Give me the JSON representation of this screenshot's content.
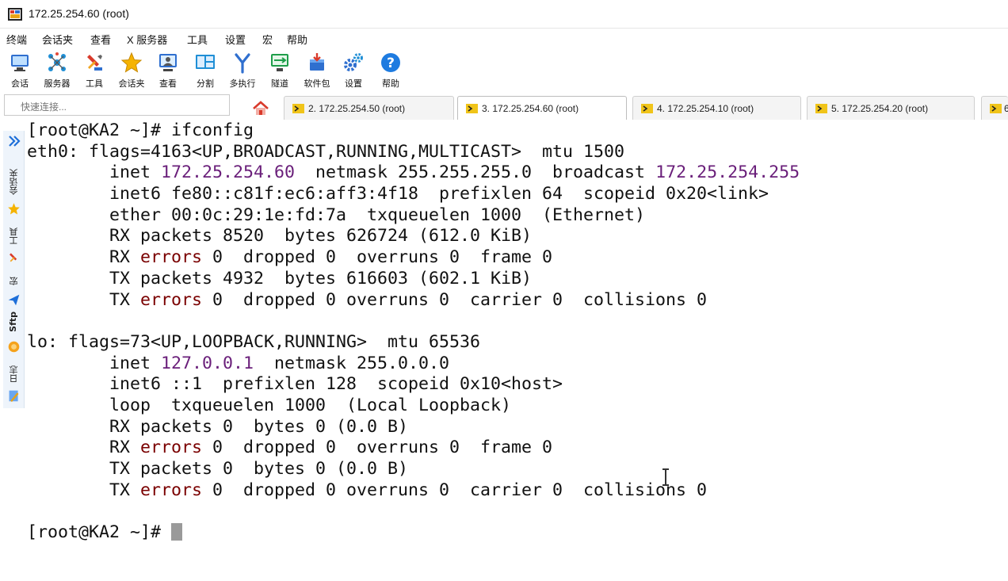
{
  "window": {
    "title": "172.25.254.60 (root)"
  },
  "menu": [
    "终端",
    "会话夹",
    "查看",
    "X 服务器",
    "工具",
    "设置",
    "宏",
    "帮助"
  ],
  "toolbar": [
    {
      "label": "会话",
      "icon": "session-icon"
    },
    {
      "label": "服务器",
      "icon": "servers-icon"
    },
    {
      "label": "工具",
      "icon": "tools-icon"
    },
    {
      "label": "会话夹",
      "icon": "favorites-star-icon"
    },
    {
      "label": "查看",
      "icon": "view-icon"
    },
    {
      "label": "分割",
      "icon": "split-icon"
    },
    {
      "label": "多执行",
      "icon": "multiexec-icon"
    },
    {
      "label": "隧道",
      "icon": "tunnel-icon"
    },
    {
      "label": "软件包",
      "icon": "packages-icon"
    },
    {
      "label": "设置",
      "icon": "settings-gears-icon"
    },
    {
      "label": "帮助",
      "icon": "help-icon"
    }
  ],
  "quick_connect": {
    "placeholder": "快速连接..."
  },
  "tabs": [
    {
      "label": "2. 172.25.254.50 (root)",
      "active": false
    },
    {
      "label": "3. 172.25.254.60 (root)",
      "active": true
    },
    {
      "label": "4. 172.25.254.10 (root)",
      "active": false
    },
    {
      "label": "5. 172.25.254.20 (root)",
      "active": false
    },
    {
      "label": "6",
      "active": false
    }
  ],
  "sidebar": {
    "sessions": "会话夹",
    "tools": "工具",
    "macros": "宏",
    "sftp": "Sftp",
    "log": "日志"
  },
  "colors": {
    "ip": "#6a1f7a",
    "error": "#7a0000",
    "accent": "#1e6fd9"
  },
  "terminal": {
    "lines": [
      [
        {
          "t": "[root@KA2 ~]# ifconfig"
        }
      ],
      [
        {
          "t": "eth0: flags=4163<UP,BROADCAST,RUNNING,MULTICAST>  mtu 1500"
        }
      ],
      [
        {
          "t": "        inet "
        },
        {
          "t": "172.25.254.60",
          "c": "ip"
        },
        {
          "t": "  netmask 255.255.255.0  broadcast "
        },
        {
          "t": "172.25.254.255",
          "c": "ip"
        }
      ],
      [
        {
          "t": "        inet6 fe80::c81f:ec6:aff3:4f18  prefixlen 64  scopeid 0x20<link>"
        }
      ],
      [
        {
          "t": "        ether 00:0c:29:1e:fd:7a  txqueuelen 1000  (Ethernet)"
        }
      ],
      [
        {
          "t": "        RX packets 8520  bytes 626724 (612.0 KiB)"
        }
      ],
      [
        {
          "t": "        RX "
        },
        {
          "t": "errors",
          "c": "err"
        },
        {
          "t": " 0  dropped 0  overruns 0  frame 0"
        }
      ],
      [
        {
          "t": "        TX packets 4932  bytes 616603 (602.1 KiB)"
        }
      ],
      [
        {
          "t": "        TX "
        },
        {
          "t": "errors",
          "c": "err"
        },
        {
          "t": " 0  dropped 0 overruns 0  carrier 0  collisions 0"
        }
      ],
      [
        {
          "t": ""
        }
      ],
      [
        {
          "t": "lo: flags=73<UP,LOOPBACK,RUNNING>  mtu 65536"
        }
      ],
      [
        {
          "t": "        inet "
        },
        {
          "t": "127.0.0.1",
          "c": "ip"
        },
        {
          "t": "  netmask 255.0.0.0"
        }
      ],
      [
        {
          "t": "        inet6 ::1  prefixlen 128  scopeid 0x10<host>"
        }
      ],
      [
        {
          "t": "        loop  txqueuelen 1000  (Local Loopback)"
        }
      ],
      [
        {
          "t": "        RX packets 0  bytes 0 (0.0 B)"
        }
      ],
      [
        {
          "t": "        RX "
        },
        {
          "t": "errors",
          "c": "err"
        },
        {
          "t": " 0  dropped 0  overruns 0  frame 0"
        }
      ],
      [
        {
          "t": "        TX packets 0  bytes 0 (0.0 B)"
        }
      ],
      [
        {
          "t": "        TX "
        },
        {
          "t": "errors",
          "c": "err"
        },
        {
          "t": " 0  dropped 0 overruns 0  carrier 0  collisions 0"
        }
      ],
      [
        {
          "t": ""
        }
      ],
      [
        {
          "t": "[root@KA2 ~]# "
        },
        {
          "cursor": true
        }
      ]
    ]
  }
}
